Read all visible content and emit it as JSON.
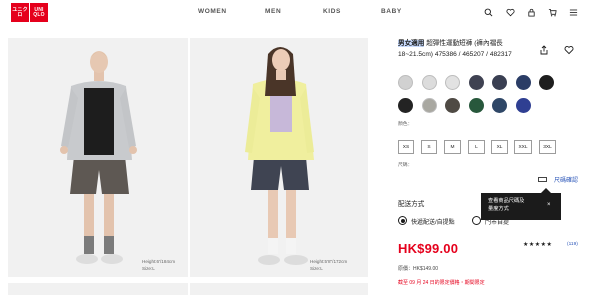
{
  "header": {
    "logo": {
      "top_left": "ユニクロ",
      "top_right": "UNI QLO"
    },
    "nav": [
      "WOMEN",
      "MEN",
      "KIDS",
      "BABY"
    ],
    "icons": [
      "search-icon",
      "heart-icon",
      "account-icon",
      "cart-icon",
      "menu-icon"
    ]
  },
  "gallery": {
    "captions": [
      {
        "height_text": "Height:6'/184cm",
        "size_text": "Size:L"
      },
      {
        "height_text": "Height:5'8\"/172cm",
        "size_text": "Size:L"
      }
    ]
  },
  "product": {
    "title_highlight": "男女適用",
    "title_rest": " 超彈性運動短褲 (褲內襠長 18~21.5cm) 475386 / 465207 / 482317",
    "color_label": "顏色：",
    "colors": [
      "#d1d1d1",
      "#dcdcdc",
      "#e2e2e2",
      "#3f4252",
      "#3a3f52",
      "#2b3d66",
      "#1e1e1e",
      "#232323",
      "#a9a8a1",
      "#4f4a44",
      "#28583c",
      "#2f4767",
      "#2f3f92"
    ],
    "size_label": "尺碼：",
    "sizes": [
      "XS",
      "S",
      "M",
      "L",
      "XL",
      "XXL",
      "3XL"
    ],
    "size_guide_link": "尺碼確認",
    "delivery_title": "配送方式",
    "delivery_options": [
      {
        "label": "快遞配送/自提點",
        "selected": true
      },
      {
        "label": "門市自提",
        "selected": false
      }
    ],
    "tooltip": {
      "line1": "查看商品尺碼及",
      "line2": "量度方式",
      "close": "×"
    },
    "price": "HK$99.00",
    "rating_stars": "★★★★★",
    "reviews": "(119)",
    "original_price": "原價：HK$149.00",
    "promo": "截至 09 月 24 日的限定價格・期間限定"
  },
  "colors": {
    "brand_red": "#e5001c",
    "link_blue": "#2a55b8"
  }
}
